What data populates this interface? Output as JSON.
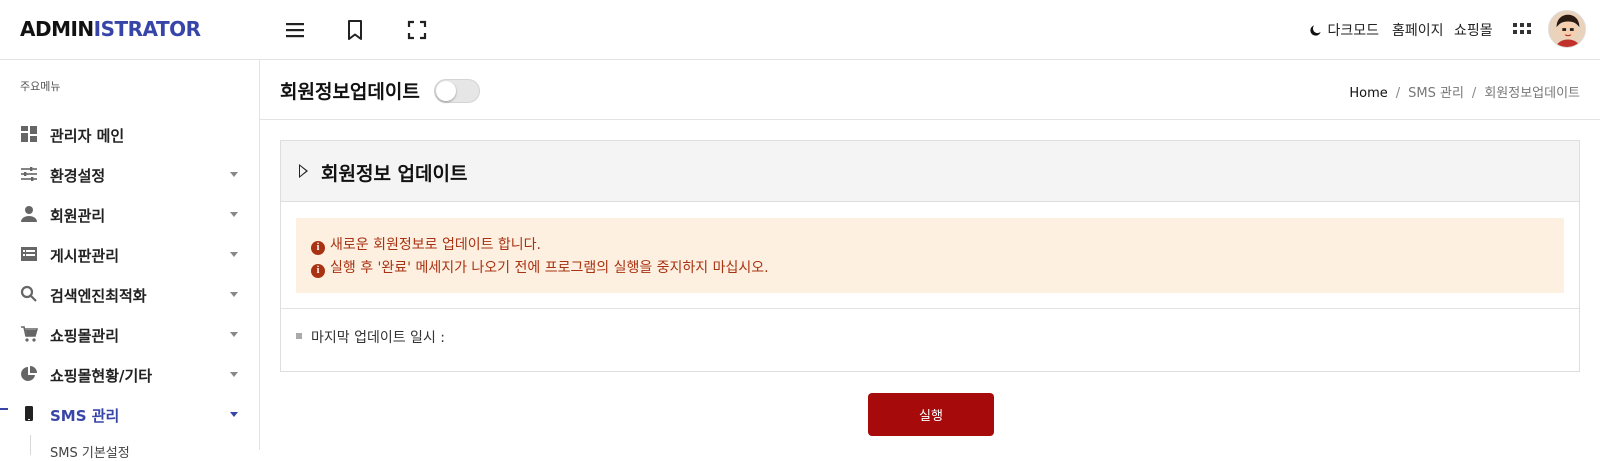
{
  "header": {
    "logo_part1": "ADMIN",
    "logo_part2": "ISTRATOR",
    "dark_mode": "다크모드",
    "homepage": "홈페이지",
    "shopping_mall": "쇼핑몰",
    "accent_color": "#3845a8"
  },
  "sidebar": {
    "heading": "주요메뉴",
    "items": [
      {
        "label": "관리자 메인",
        "icon": "dashboard-icon",
        "has_submenu": false
      },
      {
        "label": "환경설정",
        "icon": "sliders-icon",
        "has_submenu": true
      },
      {
        "label": "회원관리",
        "icon": "user-icon",
        "has_submenu": true
      },
      {
        "label": "게시판관리",
        "icon": "list-icon",
        "has_submenu": true
      },
      {
        "label": "검색엔진최적화",
        "icon": "search-icon",
        "has_submenu": true
      },
      {
        "label": "쇼핑몰관리",
        "icon": "cart-icon",
        "has_submenu": true
      },
      {
        "label": "쇼핑몰현황/기타",
        "icon": "pie-chart-icon",
        "has_submenu": true
      },
      {
        "label": "SMS 관리",
        "icon": "phone-icon",
        "has_submenu": true,
        "active": true
      }
    ],
    "sub_item": "SMS 기본설정"
  },
  "page": {
    "title": "회원정보업데이트",
    "toggle_on": false,
    "breadcrumb": {
      "home": "Home",
      "section": "SMS 관리",
      "current": "회원정보업데이트"
    }
  },
  "card": {
    "title": "회원정보 업데이트",
    "alert_lines": [
      "새로운 회원정보로 업데이트 합니다.",
      "실행 후 '완료' 메세지가 나오기 전에 프로그램의 실행을 중지하지 마십시오."
    ],
    "alert_color": "#a83212",
    "last_update_label": "마지막 업데이트 일시 :"
  },
  "actions": {
    "run_label": "실행",
    "run_color": "#a60a0a"
  }
}
